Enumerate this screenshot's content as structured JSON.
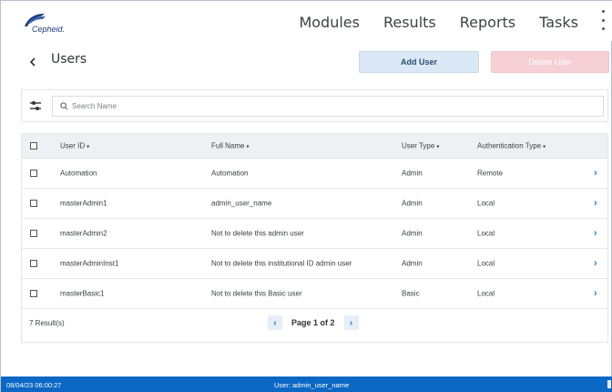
{
  "app": {
    "logo_text": "Cepheid."
  },
  "nav": {
    "items": [
      "Modules",
      "Results",
      "Reports",
      "Tasks"
    ]
  },
  "header": {
    "title": "Users",
    "add_button": "Add User",
    "delete_button": "Delete User"
  },
  "search": {
    "placeholder": "Search Name"
  },
  "table": {
    "columns": {
      "user_id": "User ID",
      "full_name": "Full Name",
      "user_type": "User Type",
      "auth_type": "Authentication Type"
    },
    "rows": [
      {
        "user_id": "Automation",
        "full_name": "Automation",
        "user_type": "Admin",
        "auth_type": "Remote"
      },
      {
        "user_id": "masterAdmin1",
        "full_name": "admin_user_name",
        "user_type": "Admin",
        "auth_type": "Local"
      },
      {
        "user_id": "masterAdmin2",
        "full_name": "Not to delete this admin user",
        "user_type": "Admin",
        "auth_type": "Local"
      },
      {
        "user_id": "masterAdminInst1",
        "full_name": "Not to delete this institutional ID admin user",
        "user_type": "Admin",
        "auth_type": "Local"
      },
      {
        "user_id": "masterBasic1",
        "full_name": "Not to delete this Basic user",
        "user_type": "Basic",
        "auth_type": "Local"
      }
    ]
  },
  "footer": {
    "result_count": "7 Result(s)",
    "page_label": "Page 1 of 2"
  },
  "status": {
    "timestamp": "08/04/23 06:00:27",
    "user": "User: admin_user_name"
  },
  "colors": {
    "status_bar": "#0b68c4",
    "add_button_bg": "#dbe9f6",
    "delete_button_bg": "#f6d0d5",
    "link_blue": "#2a78c8"
  }
}
